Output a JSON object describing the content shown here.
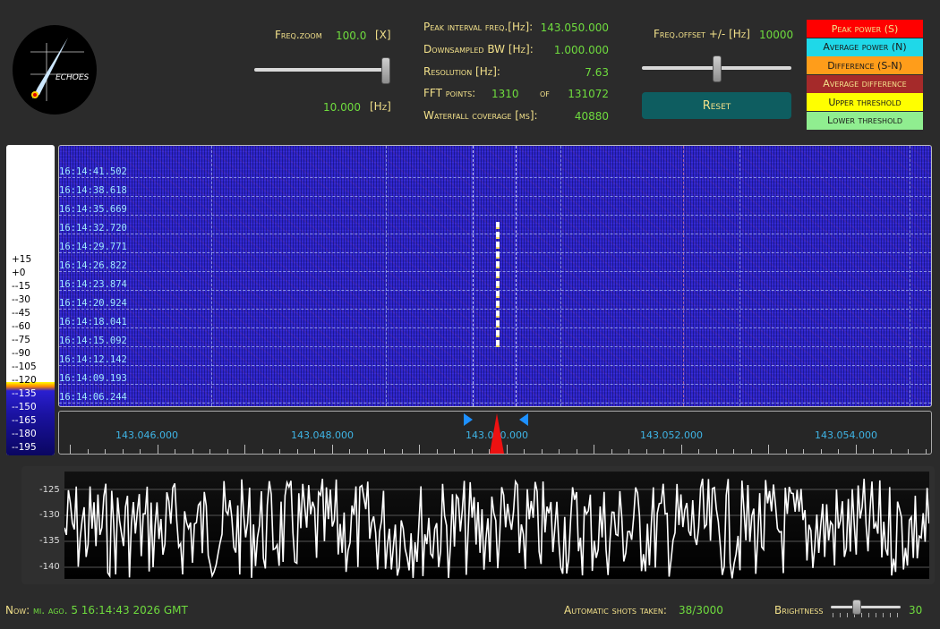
{
  "logo": {
    "text": "ECHOES"
  },
  "freq_zoom": {
    "label": "Freq.zoom",
    "value": "100.0",
    "unit": "[X]",
    "hz_value": "10.000",
    "hz_unit": "[Hz]",
    "level": 1.0
  },
  "info": [
    {
      "label": "Peak interval freq.[Hz]:",
      "value": "143.050.000"
    },
    {
      "label": "Downsampled BW [Hz]:",
      "value": "1.000.000"
    },
    {
      "label": "Resolution [Hz]:",
      "value": "7.63"
    },
    {
      "label": "Waterfall coverage [ms]:",
      "value": "40880"
    }
  ],
  "fft": {
    "label": "FFT points:",
    "value": "1310",
    "of_label": "of",
    "total": "131072"
  },
  "freq_offset": {
    "label": "Freq.offset +/- [Hz]",
    "value": "10000",
    "level": 0.5
  },
  "reset_label": "Reset",
  "legend": [
    {
      "label": "Peak power (S)",
      "bg": "#ff0000",
      "fg": "#f2e08a"
    },
    {
      "label": "Average power (N)",
      "bg": "#1fd8e8",
      "fg": "#1a1a1a"
    },
    {
      "label": "Difference (S-N)",
      "bg": "#ff9d1a",
      "fg": "#1a1a1a"
    },
    {
      "label": "Average difference",
      "bg": "#a52a2a",
      "fg": "#f2e08a"
    },
    {
      "label": "Upper threshold",
      "bg": "#ffff00",
      "fg": "#1a1a1a"
    },
    {
      "label": "Lower threshold",
      "bg": "#90ee90",
      "fg": "#1a1a1a"
    }
  ],
  "colorbar_labels": [
    "+15",
    "+0",
    "--15",
    "--30",
    "--45",
    "--60",
    "--75",
    "--90",
    "--105",
    "--120",
    "--135",
    "--150",
    "--165",
    "--180",
    "--195"
  ],
  "waterfall_times": [
    "16:14:41.502",
    "16:14:38.618",
    "16:14:35.669",
    "16:14:32.720",
    "16:14:29.771",
    "16:14:26.822",
    "16:14:23.874",
    "16:14:20.924",
    "16:14:18.041",
    "16:14:15.092",
    "16:14:12.142",
    "16:14:09.193",
    "16:14:06.244"
  ],
  "freq_scale": [
    "143.046.000",
    "143.048.000",
    "143.050.000",
    "143.052.000",
    "143.054.000"
  ],
  "spectrum_ylabels": [
    "-125",
    "-130",
    "-135",
    "-140"
  ],
  "status": {
    "now_label": "Now:",
    "now_value": "mi. ago. 5 16:14:43 2026 GMT",
    "shots_label": "Automatic shots taken:",
    "shots_value": "38/3000",
    "brightness_label": "Brightness",
    "brightness_value": "30",
    "brightness_level": 0.35
  },
  "colors": {
    "accent_yellow": "#f2e08a",
    "value_green": "#6fdc3e",
    "waterfall_blue": "#2d24c8",
    "freq_label_blue": "#3fb5e6"
  }
}
